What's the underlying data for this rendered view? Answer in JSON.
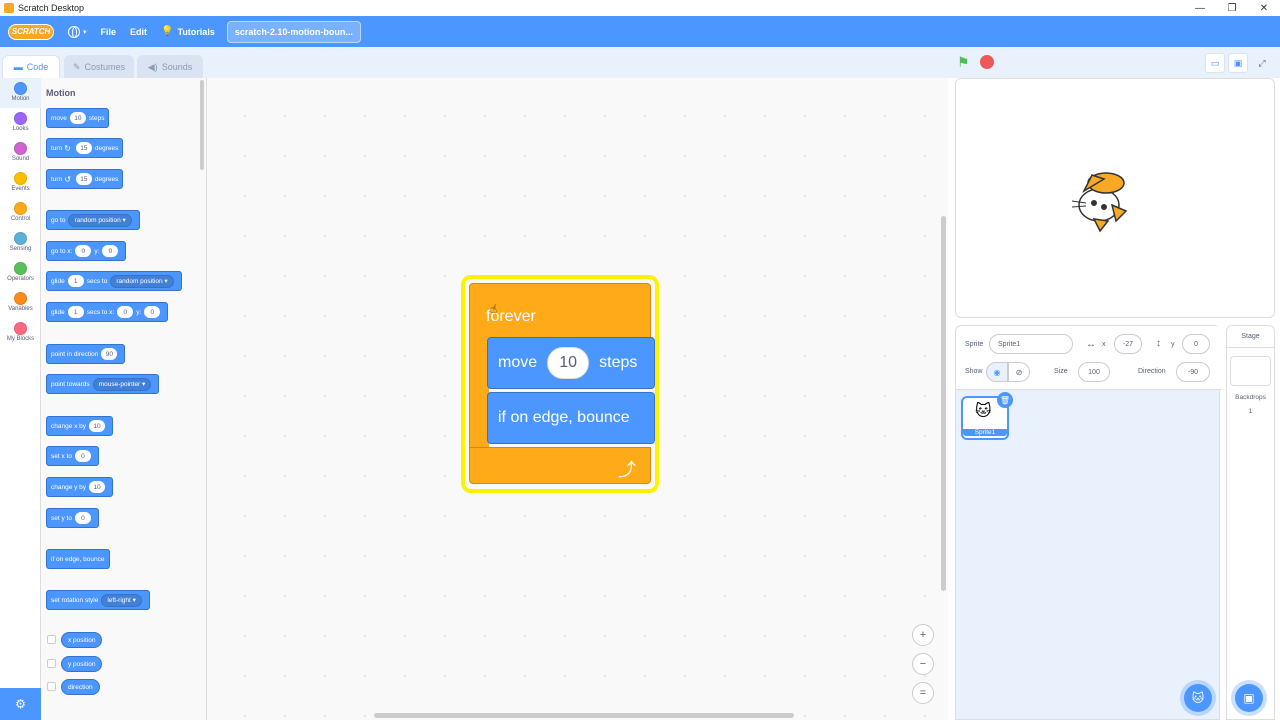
{
  "window": {
    "title": "Scratch Desktop",
    "controls": [
      "—",
      "❐",
      "✕"
    ]
  },
  "menubar": {
    "logo": "SCRATCH",
    "language_caret": "▾",
    "file": "File",
    "edit": "Edit",
    "tutorials": "Tutorials",
    "project_title": "scratch-2.10-motion-boun..."
  },
  "tabs": {
    "code": "Code",
    "costumes": "Costumes",
    "sounds": "Sounds"
  },
  "categories": [
    {
      "label": "Motion",
      "color": "#4c97ff"
    },
    {
      "label": "Looks",
      "color": "#9966ff"
    },
    {
      "label": "Sound",
      "color": "#cf63cf"
    },
    {
      "label": "Events",
      "color": "#ffbf00"
    },
    {
      "label": "Control",
      "color": "#ffab19"
    },
    {
      "label": "Sensing",
      "color": "#5cb1d6"
    },
    {
      "label": "Operators",
      "color": "#59c059"
    },
    {
      "label": "Variables",
      "color": "#ff8c1a"
    },
    {
      "label": "My Blocks",
      "color": "#ff6680"
    }
  ],
  "palette": {
    "title": "Motion",
    "move": {
      "a": "move",
      "v": "10",
      "b": "steps"
    },
    "turn_right": {
      "a": "turn",
      "v": "15",
      "b": "degrees"
    },
    "turn_left": {
      "a": "turn",
      "v": "15",
      "b": "degrees"
    },
    "goto": {
      "a": "go to",
      "dd": "random position"
    },
    "gotoxy": {
      "a": "go to x:",
      "x": "0",
      "b": "y:",
      "y": "0"
    },
    "glide_to": {
      "a": "glide",
      "v": "1",
      "b": "secs to",
      "dd": "random position"
    },
    "glide_xy": {
      "a": "glide",
      "v": "1",
      "b": "secs to x:",
      "x": "0",
      "c": "y:",
      "y": "0"
    },
    "point_dir": {
      "a": "point in direction",
      "v": "90"
    },
    "point_towards": {
      "a": "point towards",
      "dd": "mouse-pointer"
    },
    "change_x": {
      "a": "change x by",
      "v": "10"
    },
    "set_x": {
      "a": "set x to",
      "v": "0"
    },
    "change_y": {
      "a": "change y by",
      "v": "10"
    },
    "set_y": {
      "a": "set y to",
      "v": "0"
    },
    "bounce": "if on edge, bounce",
    "rotation": {
      "a": "set rotation style",
      "dd": "left-right"
    },
    "reporters": [
      "x position",
      "y position",
      "direction"
    ]
  },
  "script": {
    "forever": "forever",
    "move": {
      "a": "move",
      "v": "10",
      "b": "steps"
    },
    "bounce": "if on edge, bounce"
  },
  "zoom": {
    "in": "+",
    "out": "−",
    "reset": "="
  },
  "sprite_info": {
    "sprite_label": "Sprite",
    "sprite_name": "Sprite1",
    "x_label": "x",
    "x_value": "-27",
    "y_label": "y",
    "y_value": "0",
    "show_label": "Show",
    "size_label": "Size",
    "size_value": "100",
    "direction_label": "Direction",
    "direction_value": "-90"
  },
  "sprites": [
    {
      "name": "Sprite1"
    }
  ],
  "stage_pane": {
    "title": "Stage",
    "backdrops_label": "Backdrops",
    "backdrops_count": "1"
  },
  "colors": {
    "accent": "#4c97ff",
    "control": "#ffab19",
    "glow": "#fff200"
  }
}
